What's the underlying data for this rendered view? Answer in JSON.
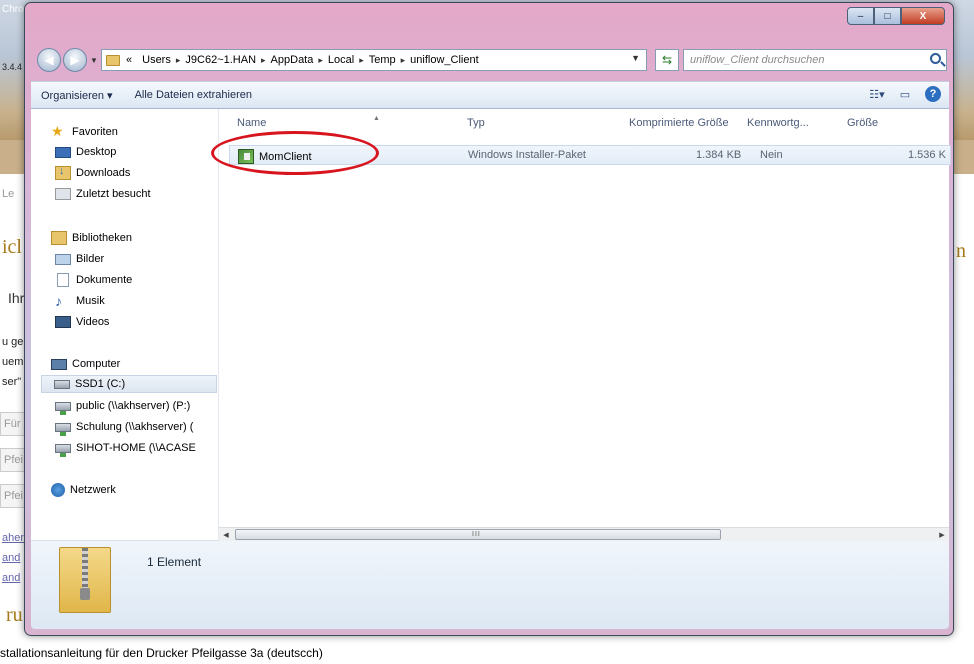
{
  "background": {
    "app_title_fragment": "Chro",
    "app_version_fragment": "3.4.4",
    "fragments": [
      "Le",
      "icl",
      "n",
      "Ihre",
      "u ge",
      "uem",
      "ser\"",
      "Für",
      "Pfei",
      "Pfei",
      "ahen",
      "and",
      "and",
      "ru"
    ],
    "footer_text": "stallationsanleitung für den Drucker Pfeilgasse 3a (deutscch)"
  },
  "window": {
    "controls": {
      "minimize": "–",
      "maximize": "□",
      "close": "X"
    }
  },
  "address_bar": {
    "overflow": "«",
    "crumbs": [
      "Users",
      "J9C62~1.HAN",
      "AppData",
      "Local",
      "Temp",
      "uniflow_Client"
    ],
    "separator": "▸"
  },
  "search": {
    "placeholder": "uniflow_Client durchsuchen"
  },
  "toolbar": {
    "organize_label": "Organisieren ▾",
    "extract_all_label": "Alle Dateien extrahieren"
  },
  "nav_pane": {
    "favorites": {
      "label": "Favoriten",
      "items": [
        "Desktop",
        "Downloads",
        "Zuletzt besucht"
      ]
    },
    "libraries": {
      "label": "Bibliotheken",
      "items": [
        "Bilder",
        "Dokumente",
        "Musik",
        "Videos"
      ]
    },
    "computer": {
      "label": "Computer",
      "items": [
        "SSD1 (C:)",
        "public (\\\\akhserver) (P:)",
        "Schulung (\\\\akhserver) (",
        "SIHOT-HOME (\\\\ACASE"
      ]
    },
    "network": {
      "label": "Netzwerk"
    }
  },
  "file_list": {
    "columns": [
      "Name",
      "Typ",
      "Komprimierte Größe",
      "Kennwortg...",
      "Größe"
    ],
    "rows": [
      {
        "name": "MomClient",
        "type": "Windows Installer-Paket",
        "compressed_size": "1.384 KB",
        "password": "Nein",
        "size": "1.536 K"
      }
    ]
  },
  "details_pane": {
    "count": "1 Element"
  },
  "colors": {
    "highlight_ring": "#d8141e",
    "selection": "#e3ecf7"
  }
}
